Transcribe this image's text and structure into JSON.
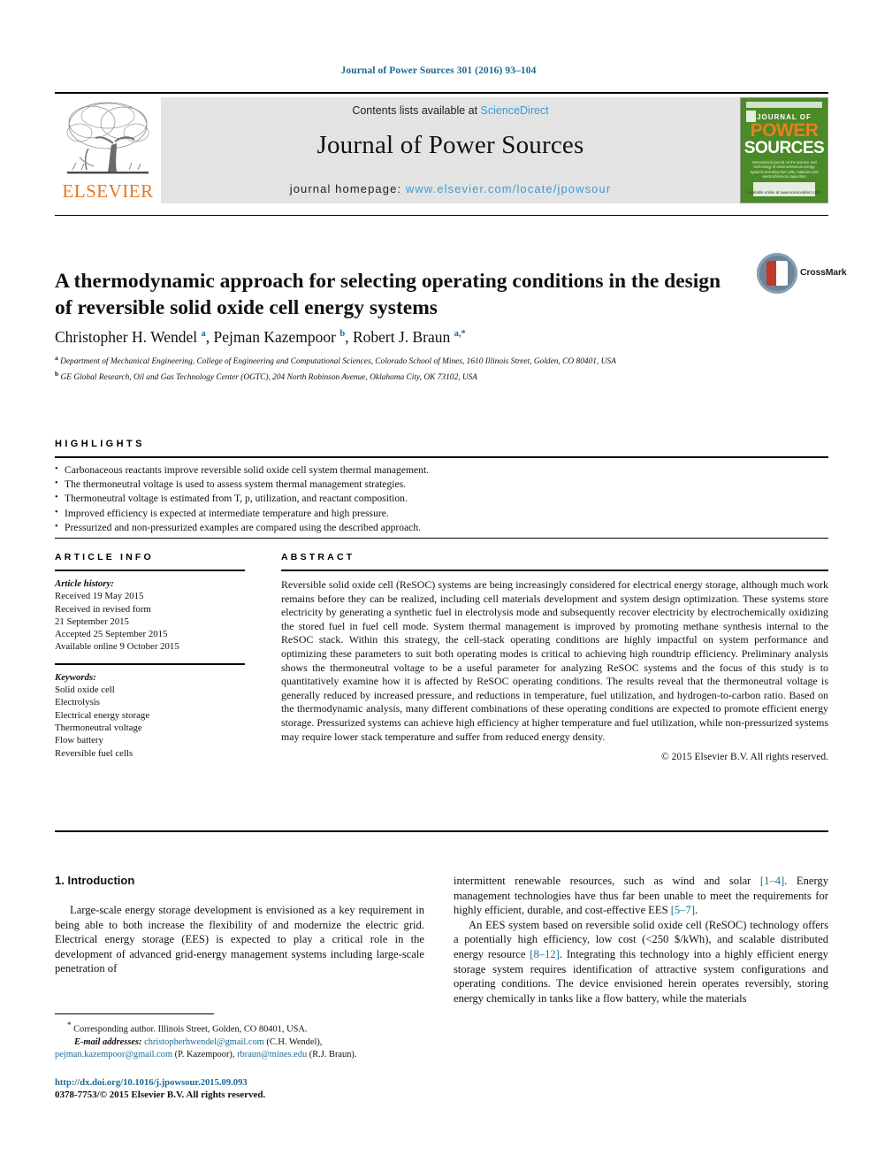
{
  "running_head": "Journal of Power Sources 301 (2016) 93–104",
  "masthead": {
    "contents_prefix": "Contents lists available at ",
    "sciencedirect": "ScienceDirect",
    "journal_name": "Journal of Power Sources",
    "homepage_prefix": "journal homepage: ",
    "homepage_url": "www.elsevier.com/locate/jpowsour",
    "elsevier_wordmark": "ELSEVIER",
    "cover": {
      "journal_of": "JOURNAL OF",
      "power": "POWER",
      "sources": "SOURCES",
      "subtitle": "International journal on the science and technology of electrochemical energy systems including fuel cells, batteries and electrochemical capacitors",
      "footer": "Available online at www.sciencedirect.com"
    },
    "accent_blue": "#3a9ad9",
    "elsevier_orange": "#E87722",
    "cover_green": "#4a8a27"
  },
  "article": {
    "title": "A thermodynamic approach for selecting operating conditions in the design of reversible solid oxide cell energy systems",
    "authors_html": "Christopher H. Wendel <sup>a</sup>, Pejman Kazempoor <sup>b</sup>, Robert J. Braun <sup>a,*</sup>",
    "authors_plain": "Christopher H. Wendel a, Pejman Kazempoor b, Robert J. Braun a,*",
    "affiliation_a": "Department of Mechanical Engineering, College of Engineering and Computational Sciences, Colorado School of Mines, 1610 Illinois Street, Golden, CO 80401, USA",
    "affiliation_b": "GE Global Research, Oil and Gas Technology Center (OGTC), 204 North Robinson Avenue, Oklahoma City, OK 73102, USA",
    "crossmark_label": "CrossMark"
  },
  "highlights": {
    "heading": "HIGHLIGHTS",
    "items": [
      "Carbonaceous reactants improve reversible solid oxide cell system thermal management.",
      "The thermoneutral voltage is used to assess system thermal management strategies.",
      "Thermoneutral voltage is estimated from T, p, utilization, and reactant composition.",
      "Improved efficiency is expected at intermediate temperature and high pressure.",
      "Pressurized and non-pressurized examples are compared using the described approach."
    ]
  },
  "article_info": {
    "heading": "ARTICLE INFO",
    "history_label": "Article history:",
    "history": [
      "Received 19 May 2015",
      "Received in revised form",
      "21 September 2015",
      "Accepted 25 September 2015",
      "Available online 9 October 2015"
    ],
    "keywords_label": "Keywords:",
    "keywords": [
      "Solid oxide cell",
      "Electrolysis",
      "Electrical energy storage",
      "Thermoneutral voltage",
      "Flow battery",
      "Reversible fuel cells"
    ]
  },
  "abstract": {
    "heading": "ABSTRACT",
    "text": "Reversible solid oxide cell (ReSOC) systems are being increasingly considered for electrical energy storage, although much work remains before they can be realized, including cell materials development and system design optimization. These systems store electricity by generating a synthetic fuel in electrolysis mode and subsequently recover electricity by electrochemically oxidizing the stored fuel in fuel cell mode. System thermal management is improved by promoting methane synthesis internal to the ReSOC stack. Within this strategy, the cell-stack operating conditions are highly impactful on system performance and optimizing these parameters to suit both operating modes is critical to achieving high roundtrip efficiency. Preliminary analysis shows the thermoneutral voltage to be a useful parameter for analyzing ReSOC systems and the focus of this study is to quantitatively examine how it is affected by ReSOC operating conditions. The results reveal that the thermoneutral voltage is generally reduced by increased pressure, and reductions in temperature, fuel utilization, and hydrogen-to-carbon ratio. Based on the thermodynamic analysis, many different combinations of these operating conditions are expected to promote efficient energy storage. Pressurized systems can achieve high efficiency at higher temperature and fuel utilization, while non-pressurized systems may require lower stack temperature and suffer from reduced energy density.",
    "copyright": "© 2015 Elsevier B.V. All rights reserved."
  },
  "introduction": {
    "section_title": "1. Introduction",
    "left_para_1": "Large-scale energy storage development is envisioned as a key requirement in being able to both increase the flexibility of and modernize the electric grid. Electrical energy storage (EES) is expected to play a critical role in the development of advanced grid-energy management systems including large-scale penetration of",
    "right_para_1_a": "intermittent renewable resources, such as wind and solar ",
    "right_para_1_ref1": "[1–4]",
    "right_para_1_b": ". Energy management technologies have thus far been unable to meet the requirements for highly efficient, durable, and cost-effective EES ",
    "right_para_1_ref2": "[5–7]",
    "right_para_1_c": ".",
    "right_para_2_a": "An EES system based on reversible solid oxide cell (ReSOC) technology offers a potentially high efficiency, low cost (<250 $/kWh), and scalable distributed energy resource ",
    "right_para_2_ref": "[8–12]",
    "right_para_2_b": ". Integrating this technology into a highly efficient energy storage system requires identification of attractive system configurations and operating conditions. The device envisioned herein operates reversibly, storing energy chemically in tanks like a flow battery, while the materials"
  },
  "footnotes": {
    "corresponding_star": "*",
    "corresponding": " Corresponding author. Illinois Street, Golden, CO 80401, USA.",
    "email_label": "E-mail addresses:",
    "email_1": "christopherhwendel@gmail.com",
    "email_1_name": " (C.H. Wendel), ",
    "email_2": "pejman.kazempoor@gmail.com",
    "email_2_name": " (P. Kazempoor), ",
    "email_3": "rbraun@mines.edu",
    "email_3_name": " (R.J. Braun)."
  },
  "footer": {
    "doi": "http://dx.doi.org/10.1016/j.jpowsour.2015.09.093",
    "issn_line": "0378-7753/© 2015 Elsevier B.V. All rights reserved."
  }
}
